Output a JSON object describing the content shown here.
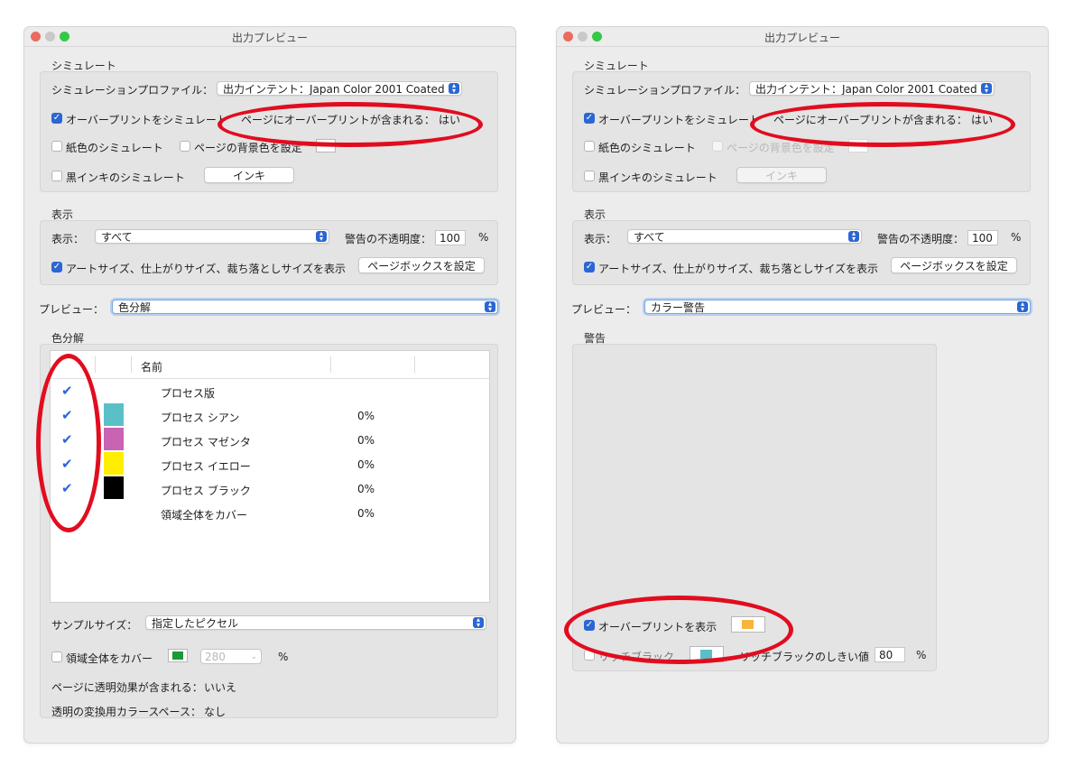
{
  "left_window": {
    "title": "出力プレビュー",
    "simulate": {
      "section": "シミュレート",
      "profile_label": "シミュレーションプロファイル：",
      "profile_value": "出力インテント：Japan Color 2001 Coated",
      "overprint_label": "オーバープリントをシミュレート",
      "overprint_info_label": "ページにオーバープリントが含まれる：",
      "overprint_info_value": "はい",
      "paper_label": "紙色のシミュレート",
      "page_bg_label": "ページの背景色を設定",
      "black_ink_label": "黒インキのシミュレート",
      "ink_button": "インキ"
    },
    "display": {
      "section": "表示",
      "show_label": "表示：",
      "show_value": "すべて",
      "warn_opacity_label": "警告の不透明度：",
      "warn_opacity_value": "100",
      "percent": "%",
      "art_size_label": "アートサイズ、仕上がりサイズ、裁ち落としサイズを表示",
      "page_box_button": "ページボックスを設定"
    },
    "preview_label": "プレビュー：",
    "preview_value": "色分解",
    "separations": {
      "section": "色分解",
      "col_name": "名前",
      "rows": [
        {
          "name": "プロセス版",
          "value": "",
          "color": ""
        },
        {
          "name": "プロセス シアン",
          "value": "0%",
          "color": "#5bbfc7"
        },
        {
          "name": "プロセス マゼンタ",
          "value": "0%",
          "color": "#c963b4"
        },
        {
          "name": "プロセス イエロー",
          "value": "0%",
          "color": "#ffee00"
        },
        {
          "name": "プロセス ブラック",
          "value": "0%",
          "color": "#000000"
        },
        {
          "name": "領域全体をカバー",
          "value": "0%",
          "color": ""
        }
      ]
    },
    "sample_size_label": "サンプルサイズ：",
    "sample_size_value": "指定したピクセル",
    "coverage_label": "領域全体をカバー",
    "coverage_value": "280",
    "coverage_percent": "%",
    "transparency_label": "ページに透明効果が含まれる：",
    "transparency_value": "いいえ",
    "blend_space_label": "透明の変換用カラースペース：",
    "blend_space_value": "なし"
  },
  "right_window": {
    "title": "出力プレビュー",
    "simulate": {
      "section": "シミュレート",
      "profile_label": "シミュレーションプロファイル：",
      "profile_value": "出力インテント：Japan Color 2001 Coated",
      "overprint_label": "オーバープリントをシミュレート",
      "overprint_info_label": "ページにオーバープリントが含まれる：",
      "overprint_info_value": "はい",
      "paper_label": "紙色のシミュレート",
      "page_bg_label": "ページの背景色を設定",
      "black_ink_label": "黒インキのシミュレート",
      "ink_button": "インキ"
    },
    "display": {
      "section": "表示",
      "show_label": "表示：",
      "show_value": "すべて",
      "warn_opacity_label": "警告の不透明度：",
      "warn_opacity_value": "100",
      "percent": "%",
      "art_size_label": "アートサイズ、仕上がりサイズ、裁ち落としサイズを表示",
      "page_box_button": "ページボックスを設定"
    },
    "preview_label": "プレビュー：",
    "preview_value": "カラー警告",
    "warning": {
      "section": "警告",
      "show_overprint_label": "オーバープリントを表示",
      "rich_black_label": "リッチブラック",
      "rich_black_threshold_label": "リッチブラックのしきい値",
      "rich_black_threshold_value": "80",
      "percent": "%"
    }
  },
  "colors": {
    "accent": "#2b66d4",
    "annotation_red": "#e10d1f",
    "overprint_swatch": "#f6b53d",
    "coverage_swatch": "#1b9a3a",
    "rich_black_swatch": "#5bbfc7"
  }
}
